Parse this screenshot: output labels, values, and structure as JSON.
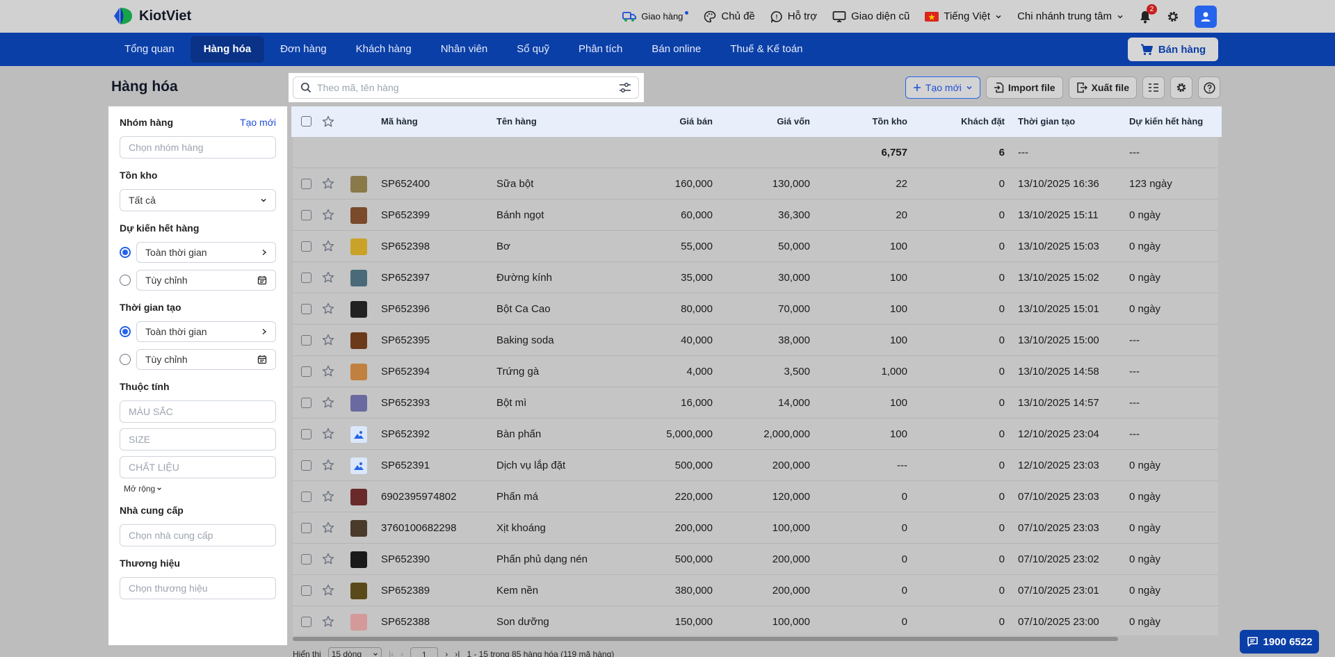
{
  "app": {
    "name": "KiotViet",
    "brand_color": "#0b3fa8"
  },
  "topbar": {
    "delivery": "Giao hàng",
    "theme": "Chủ đề",
    "support": "Hỗ trợ",
    "old_ui": "Giao diện cũ",
    "language": "Tiếng Việt",
    "branch": "Chi nhánh trung tâm",
    "notification_count": "2"
  },
  "nav": {
    "items": [
      "Tổng quan",
      "Hàng hóa",
      "Đơn hàng",
      "Khách hàng",
      "Nhân viên",
      "Sổ quỹ",
      "Phân tích",
      "Bán online",
      "Thuế & Kế toán"
    ],
    "active": "Hàng hóa",
    "sell": "Bán hàng"
  },
  "page": {
    "title": "Hàng hóa",
    "search_placeholder": "Theo mã, tên hàng",
    "create": "Tạo mới",
    "import": "Import file",
    "export": "Xuất file"
  },
  "filter": {
    "group": {
      "title": "Nhóm hàng",
      "action": "Tạo mới",
      "placeholder": "Chọn nhóm hàng"
    },
    "stock": {
      "title": "Tồn kho",
      "value": "Tất cả"
    },
    "expected_out": {
      "title": "Dự kiến hết hàng",
      "opt_all": "Toàn thời gian",
      "opt_custom": "Tùy chỉnh"
    },
    "created_time": {
      "title": "Thời gian tạo",
      "opt_all": "Toàn thời gian",
      "opt_custom": "Tùy chỉnh"
    },
    "attributes": {
      "title": "Thuộc tính",
      "color": "MÀU SẮC",
      "size": "SIZE",
      "material": "CHẤT LIỆU",
      "more": "Mở rộng"
    },
    "supplier": {
      "title": "Nhà cung cấp",
      "placeholder": "Chọn nhà cung cấp"
    },
    "brand": {
      "title": "Thương hiệu",
      "placeholder": "Chọn thương hiệu"
    }
  },
  "table": {
    "columns": [
      "Mã hàng",
      "Tên hàng",
      "Giá bán",
      "Giá vốn",
      "Tồn kho",
      "Khách đặt",
      "Thời gian tạo",
      "Dự kiến hết hàng"
    ],
    "summary": {
      "stock": "6,757",
      "ordered": "6",
      "created": "---",
      "expected": "---"
    },
    "rows": [
      {
        "code": "SP652400",
        "name": "Sữa bột",
        "price": "160,000",
        "cost": "130,000",
        "stock": "22",
        "ordered": "0",
        "created": "13/10/2025 16:36",
        "expected": "123 ngày",
        "thumb": "#8a7a4a"
      },
      {
        "code": "SP652399",
        "name": "Bánh ngọt",
        "price": "60,000",
        "cost": "36,300",
        "stock": "20",
        "ordered": "0",
        "created": "13/10/2025 15:11",
        "expected": "0 ngày",
        "thumb": "#7a4a2a"
      },
      {
        "code": "SP652398",
        "name": "Bơ",
        "price": "55,000",
        "cost": "50,000",
        "stock": "100",
        "ordered": "0",
        "created": "13/10/2025 15:03",
        "expected": "0 ngày",
        "thumb": "#c9a227"
      },
      {
        "code": "SP652397",
        "name": "Đường kính",
        "price": "35,000",
        "cost": "30,000",
        "stock": "100",
        "ordered": "0",
        "created": "13/10/2025 15:02",
        "expected": "0 ngày",
        "thumb": "#4a6a7a"
      },
      {
        "code": "SP652396",
        "name": "Bột Ca Cao",
        "price": "80,000",
        "cost": "70,000",
        "stock": "100",
        "ordered": "0",
        "created": "13/10/2025 15:01",
        "expected": "0 ngày",
        "thumb": "#222222"
      },
      {
        "code": "SP652395",
        "name": "Baking soda",
        "price": "40,000",
        "cost": "38,000",
        "stock": "100",
        "ordered": "0",
        "created": "13/10/2025 15:00",
        "expected": "---",
        "thumb": "#6a3a1a"
      },
      {
        "code": "SP652394",
        "name": "Trứng gà",
        "price": "4,000",
        "cost": "3,500",
        "stock": "1,000",
        "ordered": "0",
        "created": "13/10/2025 14:58",
        "expected": "---",
        "thumb": "#c08040"
      },
      {
        "code": "SP652393",
        "name": "Bột mì",
        "price": "16,000",
        "cost": "14,000",
        "stock": "100",
        "ordered": "0",
        "created": "13/10/2025 14:57",
        "expected": "---",
        "thumb": "#6a6aa0"
      },
      {
        "code": "SP652392",
        "name": "Bàn phấn",
        "price": "5,000,000",
        "cost": "2,000,000",
        "stock": "100",
        "ordered": "0",
        "created": "12/10/2025 23:04",
        "expected": "---",
        "thumb": "placeholder"
      },
      {
        "code": "SP652391",
        "name": "Dịch vụ lắp đặt",
        "price": "500,000",
        "cost": "200,000",
        "stock": "---",
        "ordered": "0",
        "created": "12/10/2025 23:03",
        "expected": "0 ngày",
        "thumb": "placeholder"
      },
      {
        "code": "6902395974802",
        "name": "Phấn má",
        "price": "220,000",
        "cost": "120,000",
        "stock": "0",
        "ordered": "0",
        "created": "07/10/2025 23:03",
        "expected": "0 ngày",
        "thumb": "#6a2a2a"
      },
      {
        "code": "3760100682298",
        "name": "Xịt khoáng",
        "price": "200,000",
        "cost": "100,000",
        "stock": "0",
        "ordered": "0",
        "created": "07/10/2025 23:03",
        "expected": "0 ngày",
        "thumb": "#4a3a2a"
      },
      {
        "code": "SP652390",
        "name": "Phấn phủ dạng nén",
        "price": "500,000",
        "cost": "200,000",
        "stock": "0",
        "ordered": "0",
        "created": "07/10/2025 23:02",
        "expected": "0 ngày",
        "thumb": "#1a1a1a"
      },
      {
        "code": "SP652389",
        "name": "Kem nền",
        "price": "380,000",
        "cost": "200,000",
        "stock": "0",
        "ordered": "0",
        "created": "07/10/2025 23:01",
        "expected": "0 ngày",
        "thumb": "#5a4a1a"
      },
      {
        "code": "SP652388",
        "name": "Son dưỡng",
        "price": "150,000",
        "cost": "100,000",
        "stock": "0",
        "ordered": "0",
        "created": "07/10/2025 23:00",
        "expected": "0 ngày",
        "thumb": "#d49a9a"
      }
    ]
  },
  "footer": {
    "show_label": "Hiển thị",
    "page_size": "15 dòng",
    "page": "1",
    "summary": "1 - 15 trong 85 hàng hóa (119 mã hàng)"
  },
  "hotline": "1900 6522"
}
